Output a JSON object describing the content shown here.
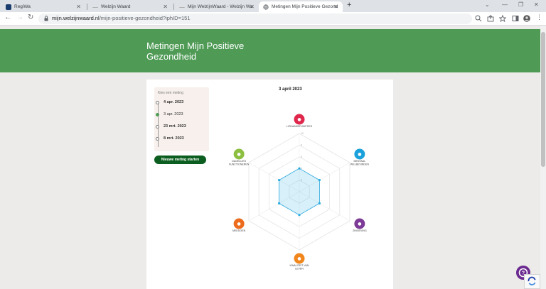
{
  "browser": {
    "tabs": [
      {
        "title": "RegiWa",
        "active": false,
        "favicon_color": "#1a3d6e"
      },
      {
        "title": "Welzijn Waard",
        "active": false,
        "favicon_color": "#b0b0b0"
      },
      {
        "title": "Mijn WelzijnWaard - Welzijn Wa",
        "active": false,
        "favicon_color": "#b0b0b0"
      },
      {
        "title": "Metingen Mijn Positieve Gezond",
        "active": true,
        "favicon_color": "#5f6368"
      }
    ],
    "url_host": "mijn.welzijnwaard.nl",
    "url_path": "/mijn-positieve-gezondheid?iphID=151"
  },
  "page": {
    "title_line1": "Metingen Mijn Positieve",
    "title_line2": "Gezondheid",
    "header_color": "#4f9b56"
  },
  "measurements": {
    "label": "Kies een meting",
    "items": [
      {
        "date": "4 apr. 2023",
        "selected": false
      },
      {
        "date": "3 apr. 2023",
        "selected": true
      },
      {
        "date": "23 mrt. 2023",
        "selected": false
      },
      {
        "date": "8 mrt. 2023",
        "selected": false
      }
    ],
    "start_button": "Nieuwe meting starten"
  },
  "chart_data": {
    "type": "radar",
    "title": "3 april 2023",
    "rmax": 10,
    "rings": [
      2,
      4,
      6,
      8,
      10
    ],
    "tick_labels": [
      "2",
      "4",
      "6",
      "8",
      "10"
    ],
    "axes": [
      {
        "label": "LICHAAMSFUNCTIES",
        "color": "#e0284d",
        "icon": "person-icon"
      },
      {
        "label": "MENTAAL WELBEVINDEN",
        "color": "#1aa1dc",
        "icon": "brain-icon"
      },
      {
        "label": "ZINGEVING",
        "color": "#7d3b97",
        "icon": "hands-icon"
      },
      {
        "label": "KWALITEIT VAN LEVEN",
        "color": "#f0861c",
        "icon": "sun-icon"
      },
      {
        "label": "MEEDOEN",
        "color": "#ec6b1c",
        "icon": "people-icon"
      },
      {
        "label": "DAGELIJKS FUNCTIONEREN",
        "color": "#8cbf3f",
        "icon": "cart-icon"
      }
    ],
    "series": [
      {
        "values": [
          4,
          4,
          4,
          4,
          4,
          4
        ],
        "color": "#29aae1"
      }
    ]
  }
}
